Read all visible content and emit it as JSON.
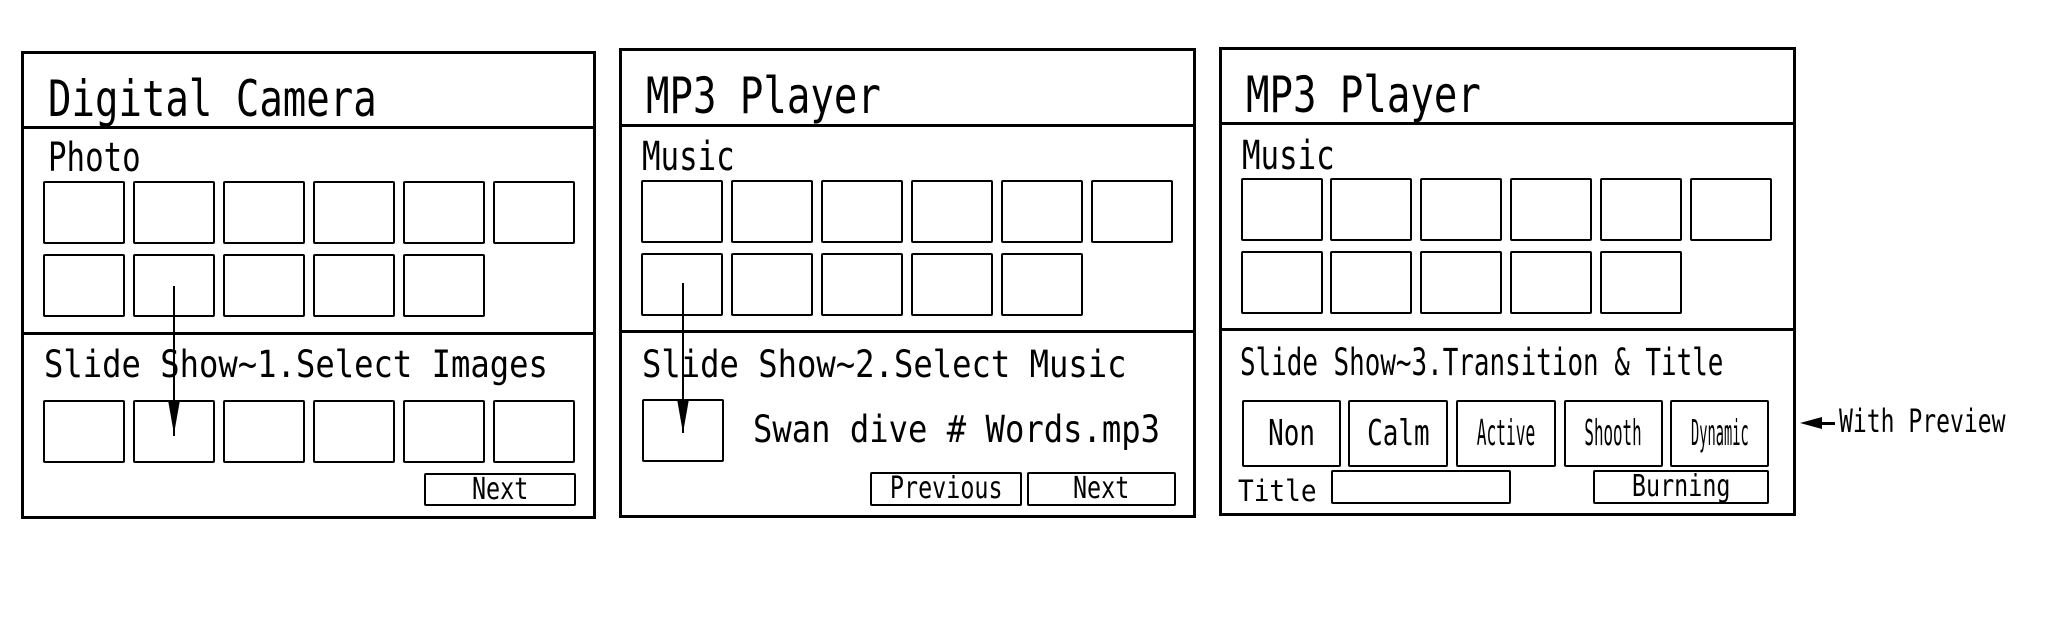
{
  "panels": [
    {
      "device_title": "Digital Camera",
      "section_label": "Photo",
      "step_label": "Slide Show~1.Select Images",
      "thumbnail_rows": [
        6,
        5
      ],
      "slot_count": 6,
      "buttons": {
        "next": "Next"
      }
    },
    {
      "device_title": "MP3 Player",
      "section_label": "Music",
      "step_label": "Slide Show~2.Select Music",
      "thumbnail_rows": [
        6,
        5
      ],
      "selected_track": "Swan dive # Words.mp3",
      "buttons": {
        "previous": "Previous",
        "next": "Next"
      }
    },
    {
      "device_title": "MP3 Player",
      "section_label": "Music",
      "step_label": "Slide Show~3.Transition & Title",
      "thumbnail_rows": [
        6,
        5
      ],
      "transitions": [
        "Non",
        "Calm",
        "Active",
        "Shooth",
        "Dynamic"
      ],
      "title_label": "Title",
      "title_value": "",
      "buttons": {
        "burning": "Burning"
      }
    }
  ],
  "callout": {
    "label": "With Preview"
  }
}
